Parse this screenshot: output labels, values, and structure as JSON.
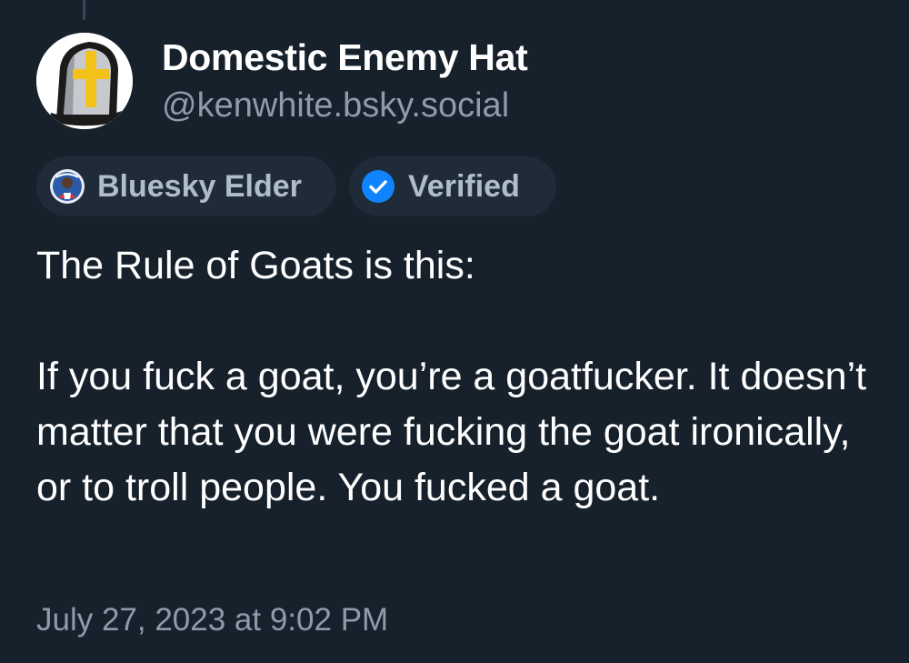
{
  "post": {
    "author": {
      "display_name": "Domestic Enemy Hat",
      "handle": "@kenwhite.bsky.social",
      "avatar_icon": "white-hat-with-yellow-cross-icon"
    },
    "badges": [
      {
        "label": "Bluesky Elder",
        "icon": "elder-avatar-icon"
      },
      {
        "label": "Verified",
        "icon": "verified-check-icon",
        "color": "#1083fe"
      }
    ],
    "text": {
      "line1": "The Rule of Goats is this:",
      "paragraph2": "If you fuck a goat, you’re a goatfucker. It doesn’t matter that you were fucking the goat ironically, or to troll people. You fucked a goat."
    },
    "timestamp": "July 27, 2023 at 9:02 PM"
  },
  "colors": {
    "background": "#17212c",
    "text_primary": "#ffffff",
    "text_secondary": "#8d9bab",
    "badge_background": "#1f2b38",
    "verified_blue": "#1083fe"
  }
}
